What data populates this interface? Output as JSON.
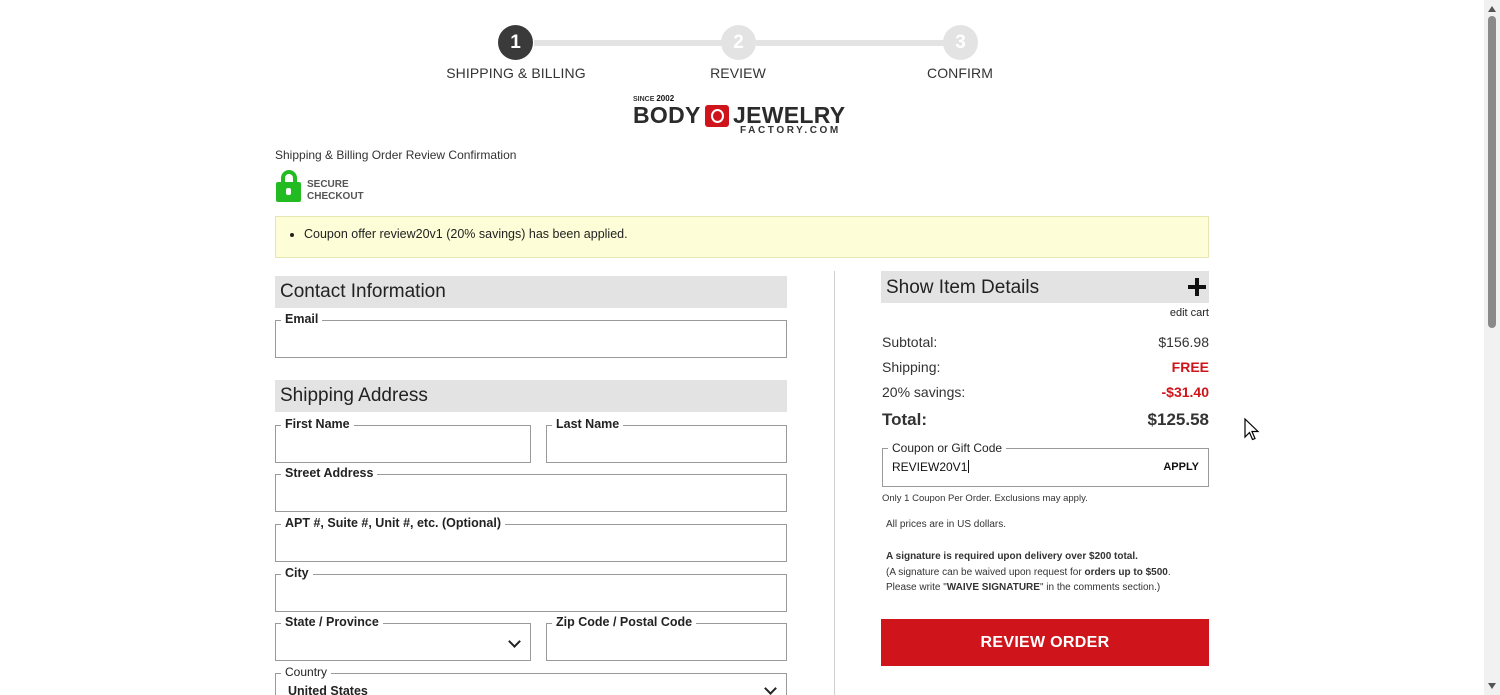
{
  "stepper": {
    "steps": [
      {
        "number": "1",
        "label": "SHIPPING & BILLING",
        "active": true
      },
      {
        "number": "2",
        "label": "REVIEW",
        "active": false
      },
      {
        "number": "3",
        "label": "CONFIRM",
        "active": false
      }
    ]
  },
  "logo": {
    "since_prefix": "SINCE ",
    "since_year": "2002",
    "word1": "BODY",
    "word2": "JEWELRY",
    "sub": "FACTORY.COM"
  },
  "breadcrumb": "Shipping & Billing Order Review Confirmation",
  "secure": {
    "line1": "SECURE",
    "line2": "CHECKOUT"
  },
  "notice": "Coupon offer review20v1 (20% savings) has been applied.",
  "contact": {
    "heading": "Contact Information",
    "email_label": "Email",
    "email_value": ""
  },
  "shipping": {
    "heading": "Shipping Address",
    "first_name_label": "First Name",
    "last_name_label": "Last Name",
    "street_label": "Street Address",
    "apt_label": "APT #, Suite #, Unit #, etc. (Optional)",
    "city_label": "City",
    "state_label": "State / Province",
    "zip_label": "Zip Code / Postal Code",
    "country_label": "Country",
    "country_value": "United States"
  },
  "summary": {
    "item_details_label": "Show Item Details",
    "edit_cart": "edit cart",
    "subtotal_label": "Subtotal:",
    "subtotal_value": "$156.98",
    "shipping_label": "Shipping:",
    "shipping_value": "FREE",
    "savings_label": "20% savings:",
    "savings_value": "-$31.40",
    "total_label": "Total:",
    "total_value": "$125.58",
    "coupon_label": "Coupon or Gift Code",
    "coupon_value": "REVIEW20V1",
    "apply_label": "APPLY",
    "coupon_note": "Only 1 Coupon Per Order. Exclusions may apply.",
    "currency_note": "All prices are in US dollars.",
    "signature_warning": "A signature is required upon delivery over $200 total.",
    "signature_note_1a": "(A signature can be waived upon request for ",
    "signature_note_1b": "orders up to $500",
    "signature_note_1c": ".",
    "signature_note_2a": "Please write \"",
    "signature_note_2b": "WAIVE SIGNATURE",
    "signature_note_2c": "\" in the comments section.)",
    "review_button": "REVIEW ORDER"
  },
  "colors": {
    "accent_red": "#d0141b",
    "secure_green": "#22bb22",
    "step_active": "#3a3a3a",
    "step_inactive": "#e3e3e3",
    "notice_bg": "#fdfdd8"
  }
}
